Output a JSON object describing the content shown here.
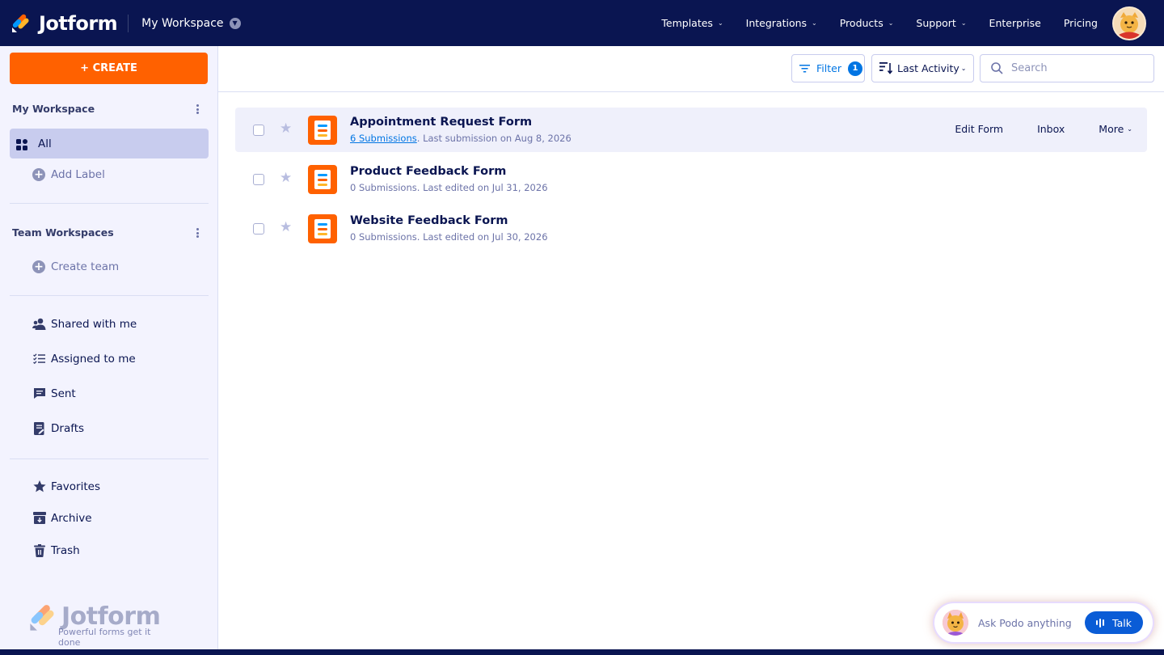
{
  "brand": {
    "name": "Jotform"
  },
  "workspace_switcher": {
    "label": "My Workspace"
  },
  "nav": {
    "items": [
      {
        "label": "Templates",
        "has_dropdown": true
      },
      {
        "label": "Integrations",
        "has_dropdown": true
      },
      {
        "label": "Products",
        "has_dropdown": true
      },
      {
        "label": "Support",
        "has_dropdown": true
      },
      {
        "label": "Enterprise",
        "has_dropdown": false
      },
      {
        "label": "Pricing",
        "has_dropdown": false
      }
    ]
  },
  "sidebar": {
    "create_label": "+ CREATE",
    "my_workspace_title": "My Workspace",
    "all_label": "All",
    "add_label": "Add Label",
    "team_title": "Team Workspaces",
    "create_team_label": "Create team",
    "shared": "Shared with me",
    "assigned": "Assigned to me",
    "sent": "Sent",
    "drafts": "Drafts",
    "favorites": "Favorites",
    "archive": "Archive",
    "trash": "Trash",
    "footer_logo_name": "Jotform",
    "footer_tagline": "Powerful forms get it done"
  },
  "toolbar": {
    "filter_label": "Filter",
    "filter_count": "1",
    "sort_label": "Last Activity",
    "search_placeholder": "Search"
  },
  "forms": [
    {
      "title": "Appointment Request Form",
      "submissions": "6 Submissions",
      "meta": ". Last submission on Aug 8, 2026",
      "active": true
    },
    {
      "title": "Product Feedback Form",
      "submissions": "",
      "meta": "0 Submissions. Last edited on Jul 31, 2026",
      "active": false
    },
    {
      "title": "Website Feedback Form",
      "submissions": "",
      "meta": "0 Submissions. Last edited on Jul 30, 2026",
      "active": false
    }
  ],
  "row_actions": {
    "edit": "Edit Form",
    "inbox": "Inbox",
    "more": "More"
  },
  "podo": {
    "prompt": "Ask Podo anything",
    "talk_label": "Talk"
  },
  "colors": {
    "navy": "#0a1551",
    "orange": "#ff6100",
    "blue": "#0075e3",
    "sidebar_bg": "#f3f3fe",
    "selected": "#c8ccee"
  }
}
